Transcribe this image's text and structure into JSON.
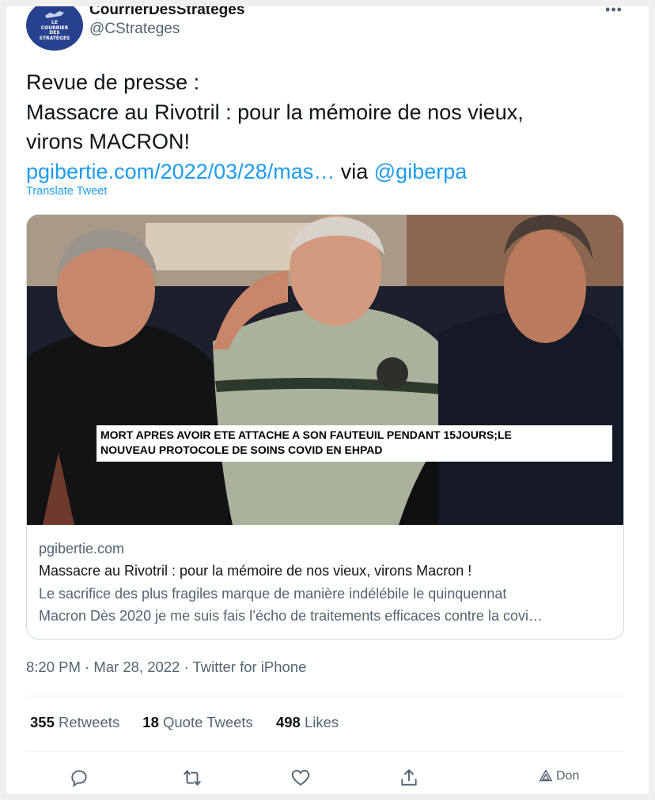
{
  "colors": {
    "link": "#1d9bf0",
    "text": "#0f1419",
    "secondary": "#536471",
    "border": "#cfd9de"
  },
  "author": {
    "display_name": "CourrierDesStratèges",
    "handle": "@CStrateges",
    "avatar_lines": [
      "LE",
      "COURRIER",
      "DES",
      "STRATÈGES"
    ]
  },
  "tweet": {
    "line1": "Revue de presse :",
    "line2": "Massacre au Rivotril : pour la mémoire de nos vieux,",
    "line3": "virons MACRON!",
    "link_text": "pgibertie.com/2022/03/28/mas…",
    "via": " via ",
    "mention": "@giberpa",
    "translate": "Translate Tweet"
  },
  "link_card": {
    "image_caption_line1": "MORT APRES AVOIR ETE ATTACHE A SON FAUTEUIL PENDANT 15JOURS;LE",
    "image_caption_line2": "NOUVEAU PROTOCOLE DE SOINS  COVID EN EHPAD",
    "domain": "pgibertie.com",
    "title": "Massacre au Rivotril : pour la mémoire de nos vieux, virons Macron !",
    "desc_line1": "Le sacrifice des plus fragiles marque de manière indélébile le quinquennat",
    "desc_line2": "Macron Dès 2020 je me suis fais l’écho de traitements efficaces contre la covi…"
  },
  "timestamp": "8:20 PM · Mar 28, 2022 · Twitter for iPhone",
  "stats": {
    "retweets_num": "355",
    "retweets_label": " Retweets",
    "quotes_num": "18",
    "quotes_label": " Quote Tweets",
    "likes_num": "498",
    "likes_label": " Likes"
  },
  "actions": {
    "icons": [
      "reply-icon",
      "retweet-icon",
      "like-icon",
      "share-icon",
      "donate-icon"
    ],
    "donate_label": "Don"
  }
}
